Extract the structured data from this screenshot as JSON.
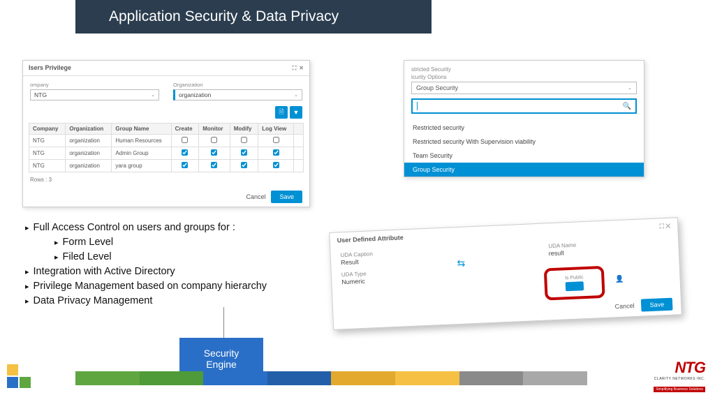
{
  "title": "Application Security & Data Privacy",
  "panel1": {
    "header": "Isers Privilege",
    "company_label": "ompany",
    "company_value": "NTG",
    "org_label": "Organization",
    "org_value": "organization",
    "columns": [
      "Company",
      "Organization",
      "Group Name",
      "Create",
      "Monitor",
      "Modify",
      "Log View"
    ],
    "rows": [
      {
        "c": "NTG",
        "o": "organization",
        "g": "Human Resources",
        "cr": false,
        "mo": false,
        "md": false,
        "lv": false
      },
      {
        "c": "NTG",
        "o": "organization",
        "g": "Admin Group",
        "cr": true,
        "mo": true,
        "md": true,
        "lv": true
      },
      {
        "c": "NTG",
        "o": "organization",
        "g": "yara group",
        "cr": true,
        "mo": true,
        "md": true,
        "lv": true
      }
    ],
    "rows_label": "Rows : 3",
    "cancel": "Cancel",
    "save": "Save"
  },
  "panel2": {
    "line1": "stricted Security",
    "line2": "icurity Options",
    "selected": "Group Security",
    "options": [
      "Restricted security",
      "Restricted security With Supervision viability",
      "Team Security",
      "Group Security"
    ]
  },
  "bullets": {
    "b1": "Full Access Control on users and groups for :",
    "b1a": "Form Level",
    "b1b": "Filed Level",
    "b2": "Integration with Active Directory",
    "b3": "Privilege Management  based on company hierarchy",
    "b4": "Data Privacy Management"
  },
  "panel3": {
    "header": "User Defined Attribute",
    "caption_label": "UDA Caption",
    "caption_value": "Result",
    "name_label": "UDA Name",
    "name_value": "result",
    "type_label": "UDA Type",
    "type_value": "Numeric",
    "public_label": "Is Public",
    "cancel": "Cancel",
    "save": "Save"
  },
  "engine": {
    "l1": "Security",
    "l2": "Engine"
  },
  "logo": {
    "brand": "NTG",
    "clarity": "CLARITY NETWORKS INC.",
    "tag": "Simplifying Business Solutions"
  }
}
